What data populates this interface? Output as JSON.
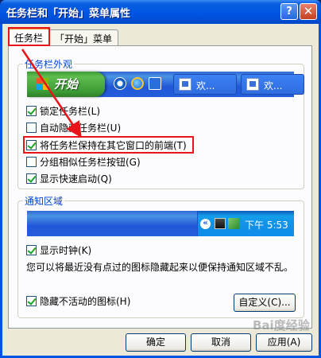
{
  "window": {
    "title": "任务栏和「开始」菜单属性",
    "help_label": "?",
    "close_label": "✕"
  },
  "tabs": [
    {
      "label": "任务栏",
      "active": true
    },
    {
      "label": "「开始」菜单",
      "active": false
    }
  ],
  "appearance": {
    "group_title": "任务栏外观",
    "start_label": "开始",
    "task_labels": [
      "欢...",
      "欢..."
    ],
    "options": [
      {
        "label": "锁定任务栏(L)",
        "checked": true
      },
      {
        "label": "自动隐藏任务栏(U)",
        "checked": false
      },
      {
        "label": "将任务栏保持在其它窗口的前端(T)",
        "checked": true
      },
      {
        "label": "分组相似任务栏按钮(G)",
        "checked": false
      },
      {
        "label": "显示快速启动(Q)",
        "checked": true
      }
    ]
  },
  "notification": {
    "group_title": "通知区域",
    "clock_text": "下午 5:53",
    "show_clock": {
      "label": "显示时钟(K)",
      "checked": true
    },
    "description": "您可以将最近没有点过的图标隐藏起来以便保持通知区域不乱。",
    "hide_inactive": {
      "label": "隐藏不活动的图标(H)",
      "checked": true
    },
    "customize_label": "自定义(C)..."
  },
  "buttons": {
    "ok": "确定",
    "cancel": "取消",
    "apply": "应用(A)"
  },
  "watermark": "Bai度经验",
  "colors": {
    "titlebar": "#0054e3",
    "dialog_bg": "#ece9d8",
    "group_title": "#0046d5",
    "annotation_red": "#e8141a",
    "start_green": "#3c9a35"
  }
}
